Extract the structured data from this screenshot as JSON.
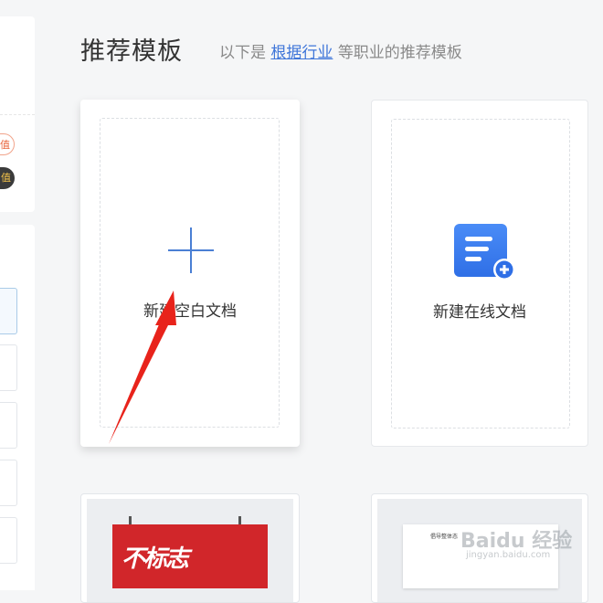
{
  "sidebar": {
    "pill_outline": "值",
    "pill_dark": "值"
  },
  "header": {
    "title": "推荐模板",
    "subtitle_prefix": "以下是",
    "subtitle_link": "根据行业",
    "subtitle_suffix": "等职业的推荐模板"
  },
  "cards": {
    "blank_doc_label": "新建空白文档",
    "online_doc_label": "新建在线文档"
  },
  "templates": {
    "poster_text": "不标志",
    "doc_heading": "倡导整体态"
  },
  "watermark": {
    "brand": "Baidu 经验",
    "url": "jingyan.baidu.com"
  },
  "colors": {
    "accent": "#4a7fd4",
    "icon_blue": "#3b82f6",
    "arrow_red": "#e8231b"
  }
}
